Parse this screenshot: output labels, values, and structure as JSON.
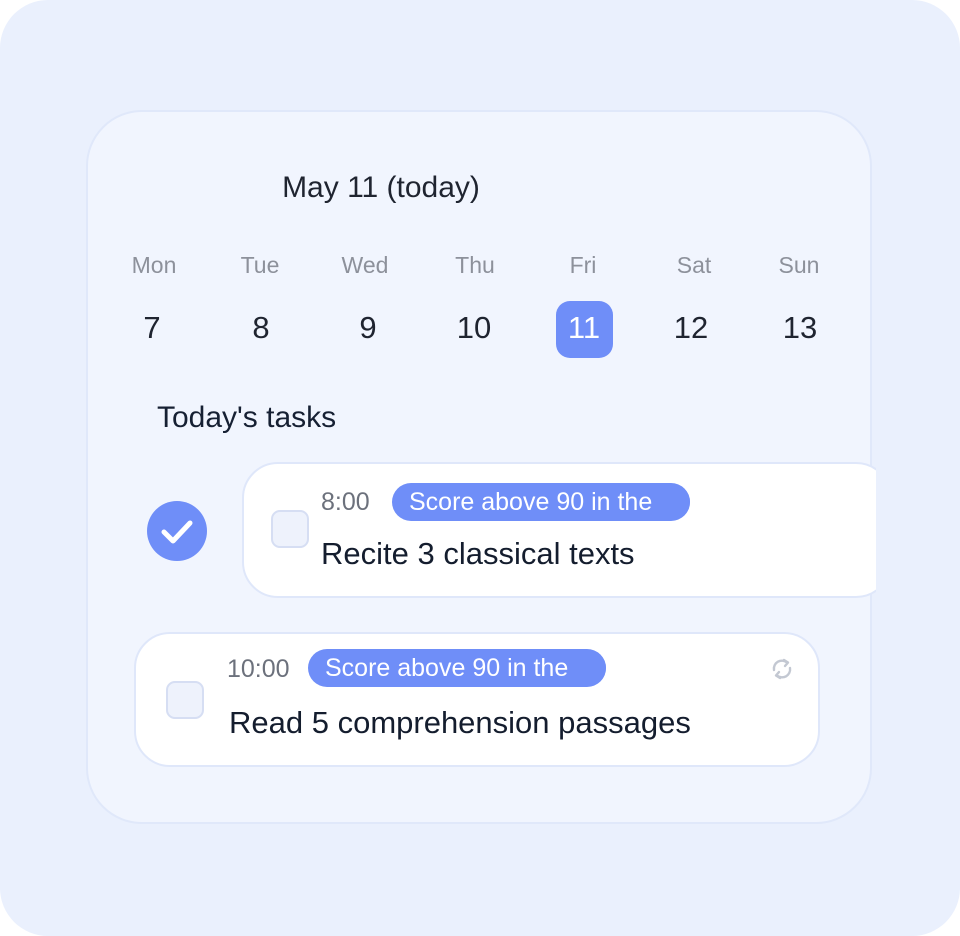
{
  "header": {
    "date_title": "May 11 (today)"
  },
  "week": {
    "days": [
      {
        "weekday": "Mon",
        "date": "7"
      },
      {
        "weekday": "Tue",
        "date": "8"
      },
      {
        "weekday": "Wed",
        "date": "9"
      },
      {
        "weekday": "Thu",
        "date": "10"
      },
      {
        "weekday": "Fri",
        "date": "11",
        "selected": true
      },
      {
        "weekday": "Sat",
        "date": "12"
      },
      {
        "weekday": "Sun",
        "date": "13"
      }
    ]
  },
  "tasks_section": {
    "title": "Today's tasks"
  },
  "tasks": [
    {
      "time": "8:00",
      "tag": "Score above 90 in the",
      "title": "Recite 3 classical texts",
      "completed_marker": true
    },
    {
      "time": "10:00",
      "tag": "Score above 90 in the",
      "title": "Read 5 comprehension passages",
      "icon": "repeat-icon"
    }
  ],
  "colors": {
    "accent": "#6f8ef8",
    "background": "#eaf0fd",
    "card": "#f1f5fe",
    "text": "#1f2430"
  }
}
